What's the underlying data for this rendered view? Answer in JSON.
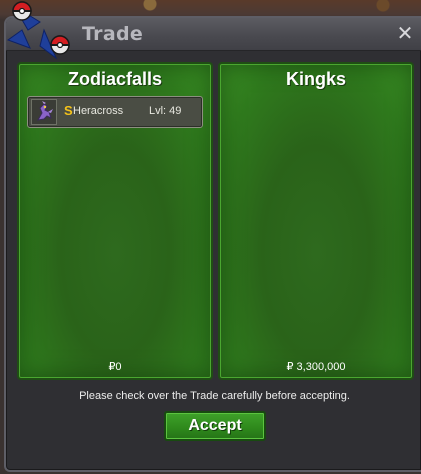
{
  "window": {
    "title": "Trade",
    "close_label": "✕"
  },
  "panels": [
    {
      "player": "Zodiacfalls",
      "items": [
        {
          "badge": "S",
          "name": "Heracross",
          "level": "Lvl: 49"
        }
      ],
      "money": "₽0"
    },
    {
      "player": "Kingks",
      "items": [],
      "money": "₽ 3,300,000"
    }
  ],
  "notice": "Please check over the Trade carefully before accepting.",
  "accept_label": "Accept",
  "colors": {
    "panel_green": "#2a6319",
    "accept_green": "#2f8a1c",
    "badge_gold": "#f4c21a",
    "window_bg": "#2f2f33"
  }
}
